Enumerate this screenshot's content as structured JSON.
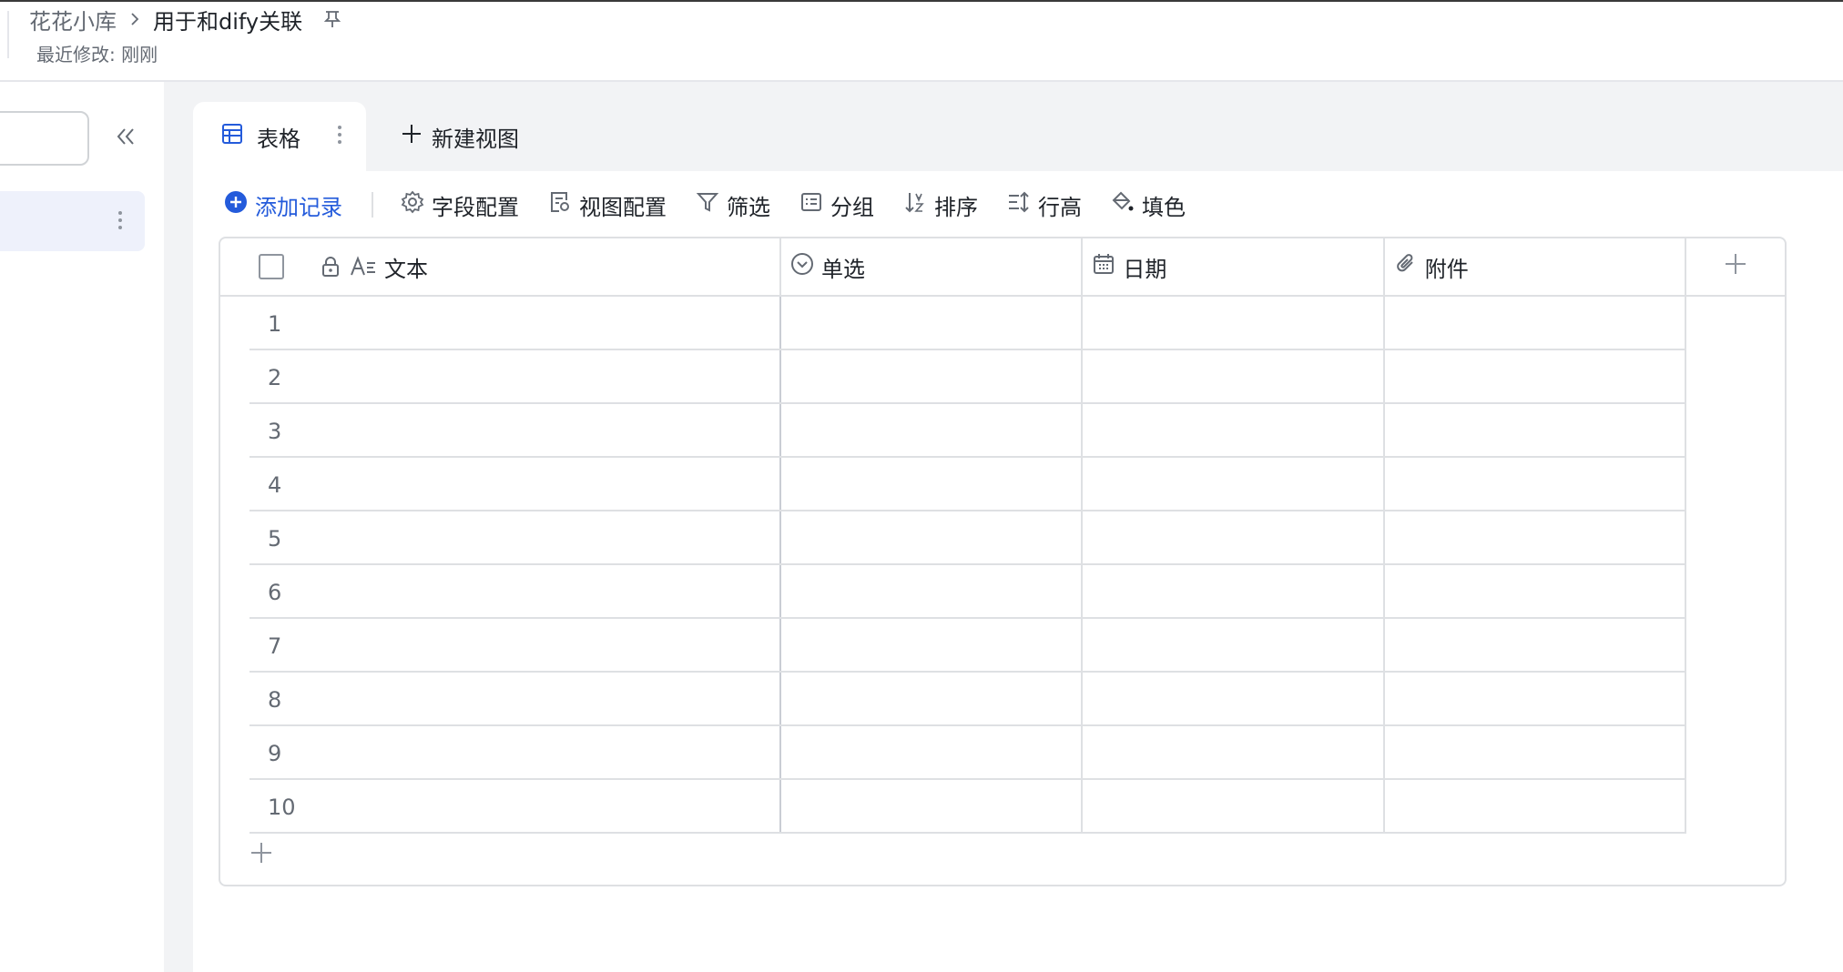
{
  "breadcrumb": {
    "root": "花花小库",
    "current": "用于和dify关联"
  },
  "header": {
    "modified": "最近修改: 刚刚"
  },
  "view_tabs": [
    {
      "label": "表格",
      "icon": "table-icon",
      "active": true
    }
  ],
  "new_view_label": "新建视图",
  "toolbar": {
    "add_record": "添加记录",
    "field_config": "字段配置",
    "view_config": "视图配置",
    "filter": "筛选",
    "group": "分组",
    "sort": "排序",
    "row_height": "行高",
    "fill_color": "填色"
  },
  "table": {
    "columns": [
      {
        "label": "文本",
        "icon": "text-field-icon",
        "locked": true
      },
      {
        "label": "单选",
        "icon": "single-select-icon"
      },
      {
        "label": "日期",
        "icon": "calendar-icon"
      },
      {
        "label": "附件",
        "icon": "paperclip-icon"
      }
    ],
    "rows": [
      "1",
      "2",
      "3",
      "4",
      "5",
      "6",
      "7",
      "8",
      "9",
      "10"
    ]
  },
  "colors": {
    "accent": "#245bdb",
    "selected_bg": "#eef1fb",
    "content_bg": "#f2f3f5",
    "border": "#dee0e3"
  }
}
